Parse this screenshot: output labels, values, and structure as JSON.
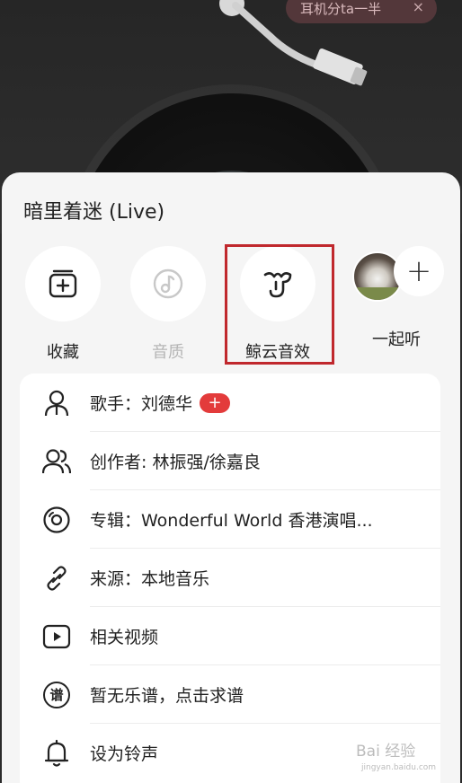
{
  "share_pill": {
    "text": "耳机分ta一半",
    "close": "×"
  },
  "song": {
    "title": "暗里着迷 (Live)"
  },
  "actions": [
    {
      "label": "收藏",
      "icon": "add-to-playlist-icon",
      "enabled": true
    },
    {
      "label": "音质",
      "icon": "music-note-icon",
      "enabled": false
    },
    {
      "label": "鲸云音效",
      "icon": "whale-sound-effect-icon",
      "enabled": true,
      "highlighted": true
    },
    {
      "label": "一起听",
      "icon": "add-listener-icon",
      "enabled": true
    }
  ],
  "together": {
    "plus": "+"
  },
  "menu": [
    {
      "icon": "singer-icon",
      "text": "歌手：刘德华",
      "badge": "+"
    },
    {
      "icon": "creators-icon",
      "text": "创作者: 林振强/徐嘉良"
    },
    {
      "icon": "album-icon",
      "text": "专辑：Wonderful World 香港演唱..."
    },
    {
      "icon": "link-icon",
      "text": "来源：本地音乐"
    },
    {
      "icon": "video-icon",
      "text": "相关视频"
    },
    {
      "icon": "sheet-music-icon",
      "text": "暂无乐谱，点击求谱",
      "icon_char": "谱"
    },
    {
      "icon": "bell-icon",
      "text": "设为铃声"
    }
  ],
  "colors": {
    "accent": "#e33b3b",
    "highlight_box": "#c0282d"
  },
  "watermark": {
    "text": "Bai 经验",
    "sub": "jingyan.baidu.com"
  }
}
